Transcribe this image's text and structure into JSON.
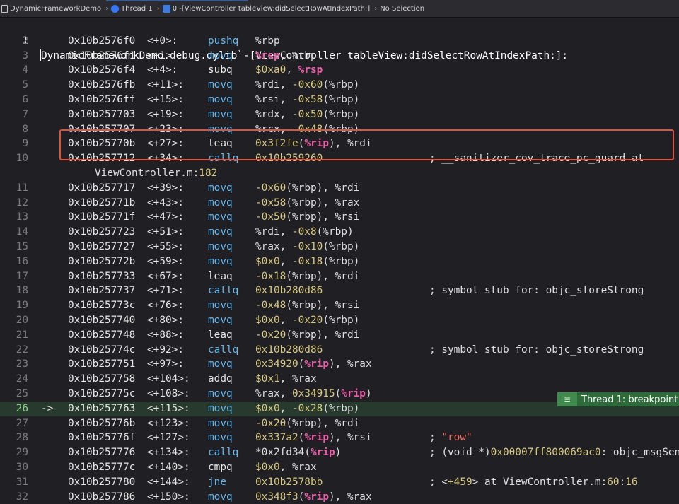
{
  "jumpbar": {
    "crumbs": [
      {
        "label": "DynamicFrameworkDemo"
      },
      {
        "label": "Thread 1"
      },
      {
        "label": "0 -[ViewController tableView:didSelectRowAtIndexPath:]"
      },
      {
        "label": "No Selection"
      }
    ]
  },
  "header": {
    "line_number": "1",
    "text": "DynamicFrameworkDemo.debug.dylib`-[ViewController tableView:didSelectRowAtIndexPath:]:"
  },
  "rows": [
    {
      "ln": "2",
      "addr": "0x10b2576f0",
      "off": "<+0>:",
      "mn": "pushq",
      "ops": [
        [
          "%rbp",
          "plain"
        ]
      ]
    },
    {
      "ln": "3",
      "addr": "0x10b2576f1",
      "off": "<+1>:",
      "mn": "movq",
      "ops": [
        [
          "%rsp",
          "pink"
        ],
        [
          ", %rbp",
          "plain"
        ]
      ]
    },
    {
      "ln": "4",
      "addr": "0x10b2576f4",
      "off": "<+4>:",
      "mn": "subq",
      "mnc": "white",
      "ops": [
        [
          "$0xa0",
          "num"
        ],
        [
          ", ",
          "plain"
        ],
        [
          "%rsp",
          "pink"
        ]
      ]
    },
    {
      "ln": "5",
      "addr": "0x10b2576fb",
      "off": "<+11>:",
      "mn": "movq",
      "ops": [
        [
          "%rdi, ",
          "plain"
        ],
        [
          "-0x60",
          "num"
        ],
        [
          "(%rbp)",
          "plain"
        ]
      ]
    },
    {
      "ln": "6",
      "addr": "0x10b2576ff",
      "off": "<+15>:",
      "mn": "movq",
      "ops": [
        [
          "%rsi, ",
          "plain"
        ],
        [
          "-0x58",
          "num"
        ],
        [
          "(%rbp)",
          "plain"
        ]
      ]
    },
    {
      "ln": "7",
      "addr": "0x10b257703",
      "off": "<+19>:",
      "mn": "movq",
      "ops": [
        [
          "%rdx, ",
          "plain"
        ],
        [
          "-0x50",
          "num"
        ],
        [
          "(%rbp)",
          "plain"
        ]
      ]
    },
    {
      "ln": "8",
      "addr": "0x10b257707",
      "off": "<+23>:",
      "mn": "movq",
      "ops": [
        [
          "%rcx, ",
          "plain"
        ],
        [
          "-0x48",
          "num"
        ],
        [
          "(%rbp)",
          "plain"
        ]
      ]
    },
    {
      "ln": "9",
      "addr": "0x10b25770b",
      "off": "<+27>:",
      "mn": "leaq",
      "mnc": "white",
      "ops": [
        [
          "0x3f2fe",
          "num"
        ],
        [
          "(",
          "plain"
        ],
        [
          "%rip",
          "pink"
        ],
        [
          "), %rdi",
          "plain"
        ]
      ]
    },
    {
      "ln": "10",
      "addr": "0x10b257712",
      "off": "<+34>:",
      "mn": "callq",
      "ops": [
        [
          "0x10b259260",
          "num"
        ]
      ],
      "cm": [
        [
          "; __sanitizer_cov_trace_pc_guard at",
          "plain"
        ]
      ]
    },
    {
      "cont": [
        [
          "ViewController.m:",
          "plain"
        ],
        [
          "182",
          "num"
        ]
      ]
    },
    {
      "ln": "11",
      "addr": "0x10b257717",
      "off": "<+39>:",
      "mn": "movq",
      "ops": [
        [
          "-0x60",
          "num"
        ],
        [
          "(%rbp), %rdi",
          "plain"
        ]
      ]
    },
    {
      "ln": "12",
      "addr": "0x10b25771b",
      "off": "<+43>:",
      "mn": "movq",
      "ops": [
        [
          "-0x58",
          "num"
        ],
        [
          "(%rbp), %rax",
          "plain"
        ]
      ]
    },
    {
      "ln": "13",
      "addr": "0x10b25771f",
      "off": "<+47>:",
      "mn": "movq",
      "ops": [
        [
          "-0x50",
          "num"
        ],
        [
          "(%rbp), %rsi",
          "plain"
        ]
      ]
    },
    {
      "ln": "14",
      "addr": "0x10b257723",
      "off": "<+51>:",
      "mn": "movq",
      "ops": [
        [
          "%rdi, ",
          "plain"
        ],
        [
          "-0x8",
          "num"
        ],
        [
          "(%rbp)",
          "plain"
        ]
      ]
    },
    {
      "ln": "15",
      "addr": "0x10b257727",
      "off": "<+55>:",
      "mn": "movq",
      "ops": [
        [
          "%rax, ",
          "plain"
        ],
        [
          "-0x10",
          "num"
        ],
        [
          "(%rbp)",
          "plain"
        ]
      ]
    },
    {
      "ln": "16",
      "addr": "0x10b25772b",
      "off": "<+59>:",
      "mn": "movq",
      "ops": [
        [
          "$0x0",
          "num"
        ],
        [
          ", ",
          "plain"
        ],
        [
          "-0x18",
          "num"
        ],
        [
          "(%rbp)",
          "plain"
        ]
      ]
    },
    {
      "ln": "17",
      "addr": "0x10b257733",
      "off": "<+67>:",
      "mn": "leaq",
      "mnc": "white",
      "ops": [
        [
          "-0x18",
          "num"
        ],
        [
          "(%rbp), %rdi",
          "plain"
        ]
      ]
    },
    {
      "ln": "18",
      "addr": "0x10b257737",
      "off": "<+71>:",
      "mn": "callq",
      "ops": [
        [
          "0x10b280d86",
          "num"
        ]
      ],
      "cm": [
        [
          "; symbol stub for: objc_storeStrong",
          "plain"
        ]
      ]
    },
    {
      "ln": "19",
      "addr": "0x10b25773c",
      "off": "<+76>:",
      "mn": "movq",
      "ops": [
        [
          "-0x48",
          "num"
        ],
        [
          "(%rbp), %rsi",
          "plain"
        ]
      ]
    },
    {
      "ln": "20",
      "addr": "0x10b257740",
      "off": "<+80>:",
      "mn": "movq",
      "ops": [
        [
          "$0x0",
          "num"
        ],
        [
          ", ",
          "plain"
        ],
        [
          "-0x20",
          "num"
        ],
        [
          "(%rbp)",
          "plain"
        ]
      ]
    },
    {
      "ln": "21",
      "addr": "0x10b257748",
      "off": "<+88>:",
      "mn": "leaq",
      "mnc": "white",
      "ops": [
        [
          "-0x20",
          "num"
        ],
        [
          "(%rbp), %rdi",
          "plain"
        ]
      ]
    },
    {
      "ln": "22",
      "addr": "0x10b25774c",
      "off": "<+92>:",
      "mn": "callq",
      "ops": [
        [
          "0x10b280d86",
          "num"
        ]
      ],
      "cm": [
        [
          "; symbol stub for: objc_storeStrong",
          "plain"
        ]
      ]
    },
    {
      "ln": "23",
      "addr": "0x10b257751",
      "off": "<+97>:",
      "mn": "movq",
      "ops": [
        [
          "0x34920",
          "num"
        ],
        [
          "(",
          "plain"
        ],
        [
          "%rip",
          "pink"
        ],
        [
          "), %rax",
          "plain"
        ]
      ]
    },
    {
      "ln": "24",
      "addr": "0x10b257758",
      "off": "<+104>:",
      "mn": "addq",
      "mnc": "white",
      "ops": [
        [
          "$0x1",
          "num"
        ],
        [
          ", %rax",
          "plain"
        ]
      ]
    },
    {
      "ln": "25",
      "addr": "0x10b25775c",
      "off": "<+108>:",
      "mn": "movq",
      "ops": [
        [
          "%rax, ",
          "plain"
        ],
        [
          "0x34915",
          "num"
        ],
        [
          "(",
          "plain"
        ],
        [
          "%rip",
          "pink"
        ],
        [
          ")",
          "plain"
        ]
      ]
    },
    {
      "ln": "26",
      "arrow": "->",
      "current": true,
      "addr": "0x10b257763",
      "off": "<+115>:",
      "mn": "movq",
      "ops": [
        [
          "$0x0",
          "num"
        ],
        [
          ", ",
          "plain"
        ],
        [
          "-0x28",
          "num"
        ],
        [
          "(%rbp)",
          "plain"
        ]
      ]
    },
    {
      "ln": "27",
      "addr": "0x10b25776b",
      "off": "<+123>:",
      "mn": "movq",
      "ops": [
        [
          "-0x20",
          "num"
        ],
        [
          "(%rbp), %rdi",
          "plain"
        ]
      ]
    },
    {
      "ln": "28",
      "addr": "0x10b25776f",
      "off": "<+127>:",
      "mn": "movq",
      "ops": [
        [
          "0x337a2",
          "num"
        ],
        [
          "(",
          "plain"
        ],
        [
          "%rip",
          "pink"
        ],
        [
          "), %rsi",
          "plain"
        ]
      ]
    },
    {
      "ln": "29",
      "addr": "0x10b257776",
      "off": "<+134>:",
      "mn": "callq",
      "ops": [
        [
          "*0x2fd34",
          "plain"
        ],
        [
          "(",
          "plain"
        ],
        [
          "%rip",
          "pink"
        ],
        [
          ")",
          "plain"
        ]
      ],
      "cm": [
        [
          "; (void *)",
          "plain"
        ],
        [
          "0x00007ff800069ac0",
          "num"
        ],
        [
          ": objc_msgSend",
          "plain"
        ]
      ]
    },
    {
      "ln": "30",
      "addr": "0x10b25777c",
      "off": "<+140>:",
      "mn": "cmpq",
      "mnc": "white",
      "ops": [
        [
          "$0x0",
          "num"
        ],
        [
          ", %rax",
          "plain"
        ]
      ]
    },
    {
      "ln": "31",
      "addr": "0x10b257780",
      "off": "<+144>:",
      "mn": "jne",
      "ops": [
        [
          "0x10b2578bb",
          "num"
        ]
      ],
      "cm": [
        [
          "; <",
          "plain"
        ],
        [
          "+459",
          "num"
        ],
        [
          "> at ViewController.m:",
          "plain"
        ],
        [
          "60",
          "num"
        ],
        [
          ":",
          "plain"
        ],
        [
          "16",
          "num"
        ]
      ]
    },
    {
      "ln": "32",
      "addr": "0x10b257786",
      "off": "<+150>:",
      "mn": "movq",
      "ops": [
        [
          "0x348f3",
          "num"
        ],
        [
          "(",
          "plain"
        ],
        [
          "%rip",
          "pink"
        ],
        [
          "), %rax",
          "plain"
        ]
      ]
    },
    {
      "ln": "33",
      "addr": "0x10b25778d",
      "off": "<+157>:",
      "mn": "addq",
      "mnc": "white",
      "ops": [
        [
          "$0x1",
          "num"
        ],
        [
          ", %rax",
          "plain"
        ]
      ]
    }
  ],
  "row28_comment": [
    [
      "; ",
      "plain"
    ],
    [
      "\"row\"",
      "str"
    ]
  ],
  "breakpoint_badge": {
    "label": "Thread 1: breakpoint",
    "icon": "breakpoint-list-icon"
  }
}
